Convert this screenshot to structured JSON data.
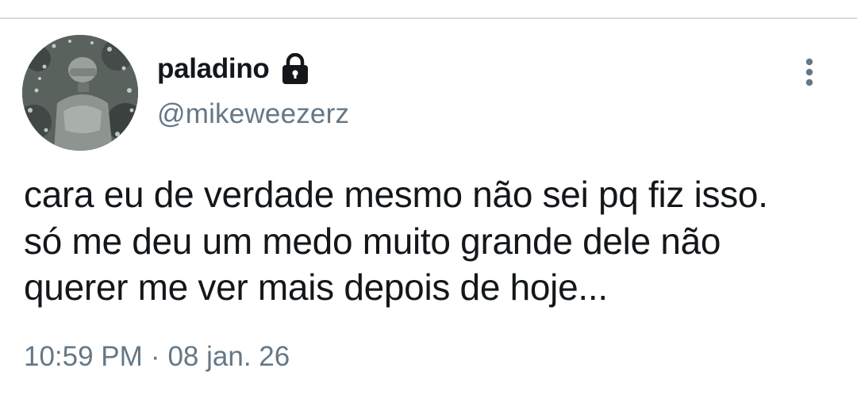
{
  "tweet": {
    "author": {
      "display_name": "paladino",
      "handle": "@mikeweezerz",
      "protected_icon": "lock-icon",
      "avatar_icon": "profile-photo"
    },
    "text_lines": [
      "cara eu de verdade mesmo não sei pq fiz isso.",
      "só me deu um medo muito grande dele não",
      "querer me ver mais depois de hoje..."
    ],
    "time": "10:59 PM",
    "separator": "·",
    "date": "08 jan. 26",
    "more_icon": "more-vertical-icon"
  },
  "colors": {
    "primary_text": "#14171a",
    "secondary_text": "#657786",
    "divider": "#d6d9dc",
    "background": "#ffffff"
  }
}
